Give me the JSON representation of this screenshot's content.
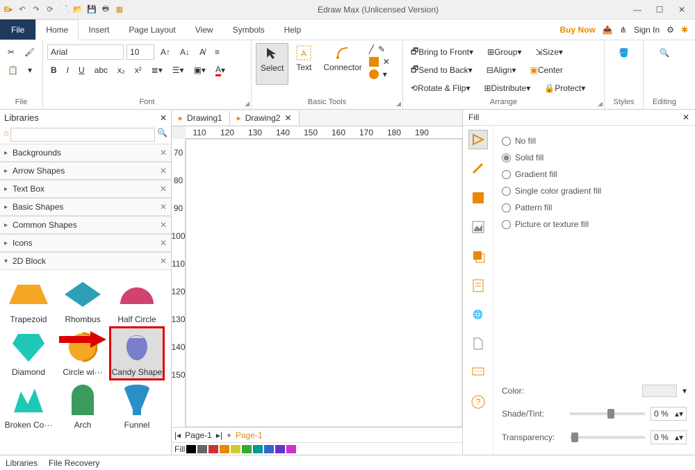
{
  "app": {
    "title": "Edraw Max (Unlicensed Version)"
  },
  "menubar": {
    "file": "File",
    "tabs": [
      "Home",
      "Insert",
      "Page Layout",
      "View",
      "Symbols",
      "Help"
    ],
    "active": 0,
    "buy": "Buy Now",
    "signin": "Sign In"
  },
  "ribbon": {
    "file_group": "File",
    "font_group": "Font",
    "font_name": "Arial",
    "font_size": "10",
    "basic_tools_group": "Basic Tools",
    "select": "Select",
    "text": "Text",
    "connector": "Connector",
    "arrange_group": "Arrange",
    "bring_front": "Bring to Front",
    "send_back": "Send to Back",
    "rotate_flip": "Rotate & Flip",
    "group": "Group",
    "align": "Align",
    "distribute": "Distribute",
    "size": "Size",
    "center": "Center",
    "protect": "Protect",
    "styles": "Styles",
    "editing": "Editing"
  },
  "libraries": {
    "title": "Libraries",
    "categories": [
      "Backgrounds",
      "Arrow Shapes",
      "Text Box",
      "Basic Shapes",
      "Common Shapes",
      "Icons",
      "2D Block"
    ],
    "shapes": [
      [
        "Trapezoid",
        "Rhombus",
        "Half Circle"
      ],
      [
        "Diamond",
        "Circle wi···",
        "Candy Shape"
      ],
      [
        "Broken Co···",
        "Arch",
        "Funnel"
      ]
    ]
  },
  "docs": {
    "tabs": [
      "Drawing1",
      "Drawing2"
    ],
    "active": 1
  },
  "ruler_h": [
    "110",
    "120",
    "130",
    "140",
    "150",
    "160",
    "170",
    "180",
    "190"
  ],
  "ruler_v": [
    "70",
    "80",
    "90",
    "100",
    "110",
    "120",
    "130",
    "140",
    "150"
  ],
  "pagebar": {
    "page_tab": "Page-1",
    "page_label": "Page-1",
    "fill": "Fill"
  },
  "fill": {
    "title": "Fill",
    "options": [
      "No fill",
      "Solid fill",
      "Gradient fill",
      "Single color gradient fill",
      "Pattern fill",
      "Picture or texture fill"
    ],
    "selected": 1,
    "color_label": "Color:",
    "shade_label": "Shade/Tint:",
    "shade_value": "0 %",
    "trans_label": "Transparency:",
    "trans_value": "0 %"
  },
  "bottombar": {
    "libraries": "Libraries",
    "recovery": "File Recovery"
  }
}
